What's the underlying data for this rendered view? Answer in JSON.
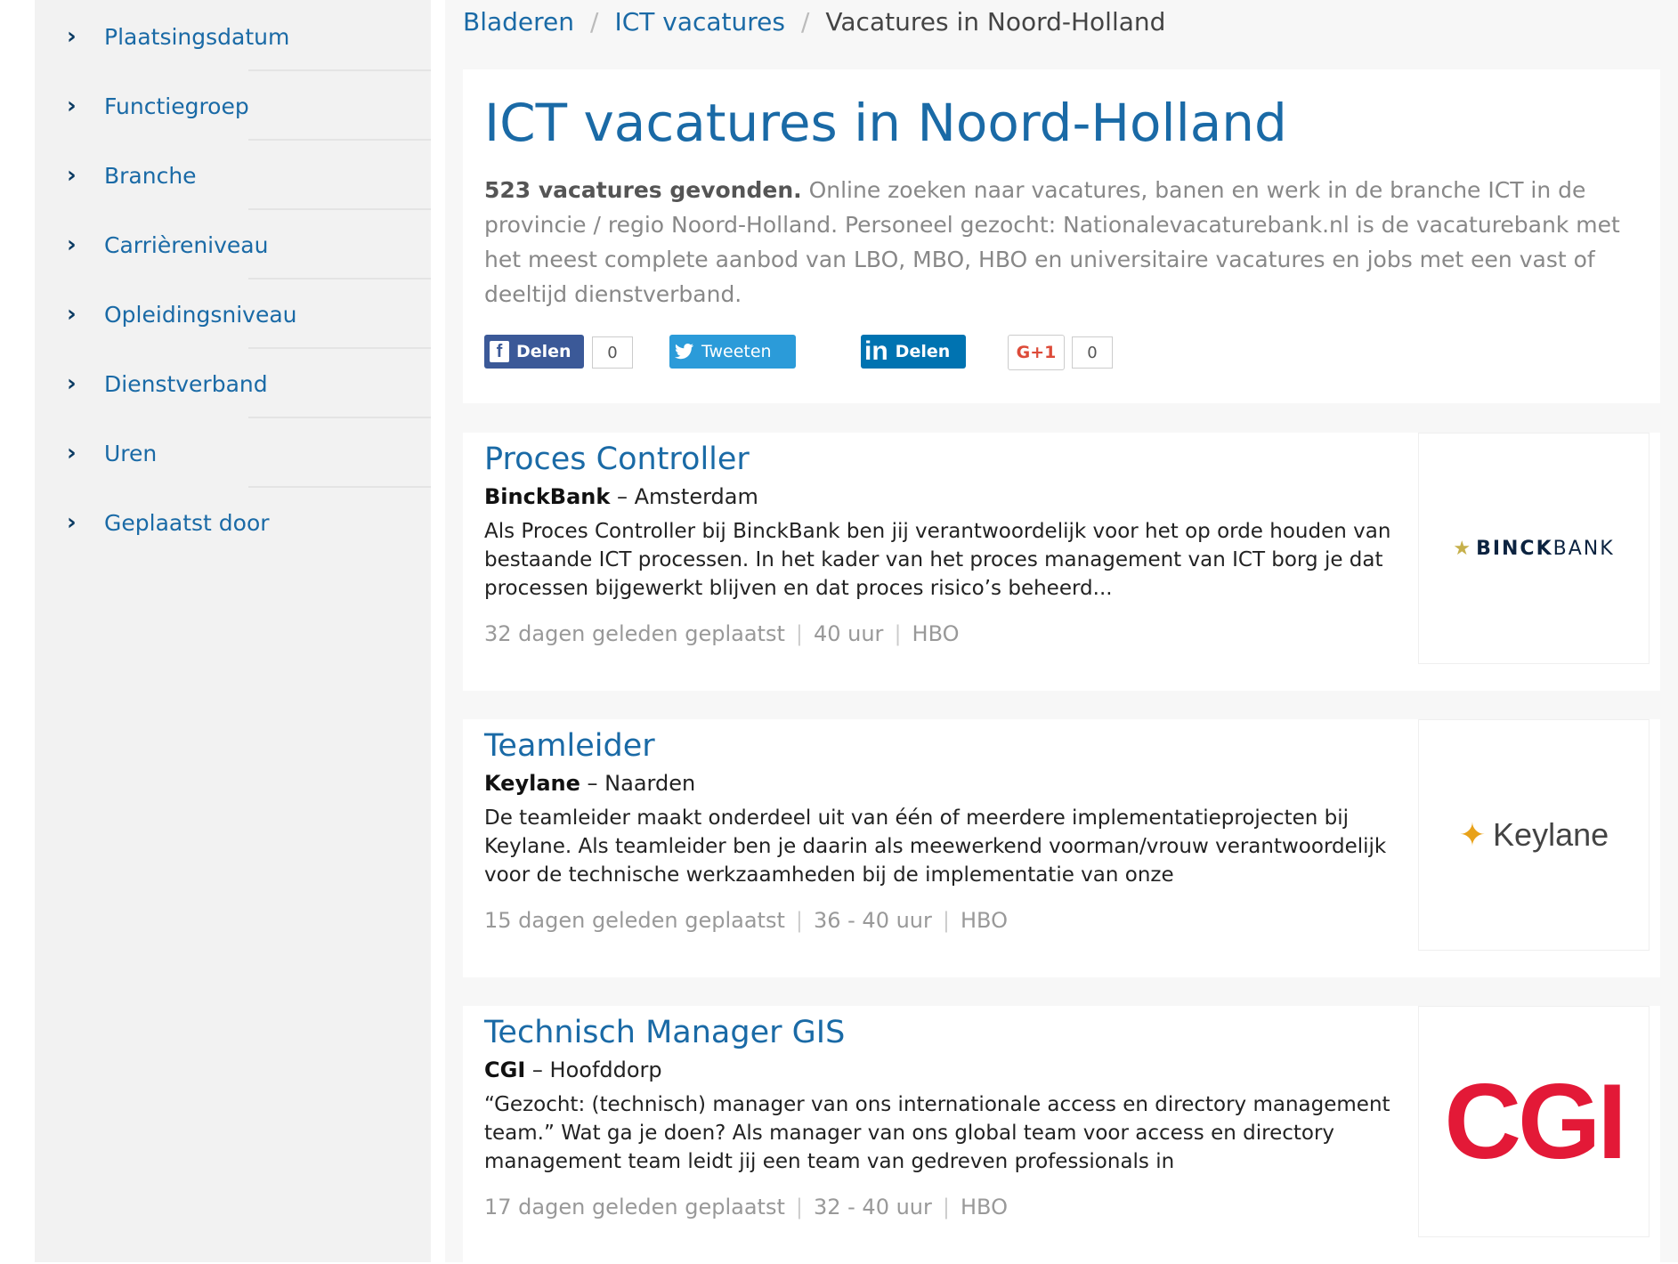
{
  "sidebar": {
    "filters": [
      {
        "label": "Plaatsingsdatum"
      },
      {
        "label": "Functiegroep"
      },
      {
        "label": "Branche"
      },
      {
        "label": "Carrièreniveau"
      },
      {
        "label": "Opleidingsniveau"
      },
      {
        "label": "Dienstverband"
      },
      {
        "label": "Uren"
      },
      {
        "label": "Geplaatst door"
      }
    ],
    "chevron_icon": "chevron-right-icon"
  },
  "breadcrumb": {
    "items": [
      "Bladeren",
      "ICT vacatures"
    ],
    "current": "Vacatures in Noord-Holland",
    "separator": "/"
  },
  "header": {
    "title": "ICT vacatures in Noord-Holland",
    "count_text": "523 vacatures gevonden.",
    "description": "Online zoeken naar vacatures, banen en werk in de branche ICT in de provincie / regio Noord-Holland. Personeel gezocht: Nationalevacaturebank.nl is de vacaturebank met het meest complete aanbod van LBO, MBO, HBO en universitaire vacatures en jobs met een vast of deeltijd dienstverband."
  },
  "share": {
    "facebook_label": "Delen",
    "facebook_count": "0",
    "twitter_label": "Tweeten",
    "linkedin_label": "Delen",
    "gplus_label": "G+1",
    "gplus_count": "0",
    "facebook_icon": "f",
    "linkedin_icon": "in"
  },
  "jobs": [
    {
      "title": "Proces Controller",
      "company": "BinckBank",
      "location": "Amsterdam",
      "description": "Als Proces Controller bij BinckBank ben jij verantwoordelijk voor het op orde houden van bestaande ICT processen. In het kader van het proces management van ICT borg je dat processen bijgewerkt blijven en dat proces risico’s beheerd...",
      "posted": "32 dagen geleden geplaatst",
      "hours": "40 uur",
      "level": "HBO",
      "logo_text_bold": "BINCK",
      "logo_text_light": "BANK"
    },
    {
      "title": "Teamleider",
      "company": "Keylane",
      "location": "Naarden",
      "description": "De teamleider maakt onderdeel uit van één of meerdere implementatieprojecten bij Keylane. Als teamleider ben je daarin als meewerkend voorman/vrouw verantwoordelijk voor de technische werkzaamheden bij de implementatie van onze",
      "posted": "15 dagen geleden geplaatst",
      "hours": "36 - 40 uur",
      "level": "HBO",
      "logo_text": "Keylane"
    },
    {
      "title": "Technisch Manager GIS",
      "company": "CGI",
      "location": "Hoofddorp",
      "description": "“Gezocht: (technisch) manager van ons internationale access en directory management team.”   Wat ga je doen? Als manager van ons global team voor access en directory management team leidt jij een team van gedreven professionals in",
      "posted": "17 dagen geleden geplaatst",
      "hours": "32 - 40 uur",
      "level": "HBO",
      "logo_text": "CGI"
    }
  ],
  "company_separator": "–",
  "meta_separator": "|",
  "colors": {
    "link_blue": "#1a6aa6",
    "sidebar_bg": "#f2f2f2",
    "facebook": "#3b5998",
    "twitter": "#2b9bd9",
    "linkedin": "#0073b1",
    "cgi_red": "#e31937"
  }
}
